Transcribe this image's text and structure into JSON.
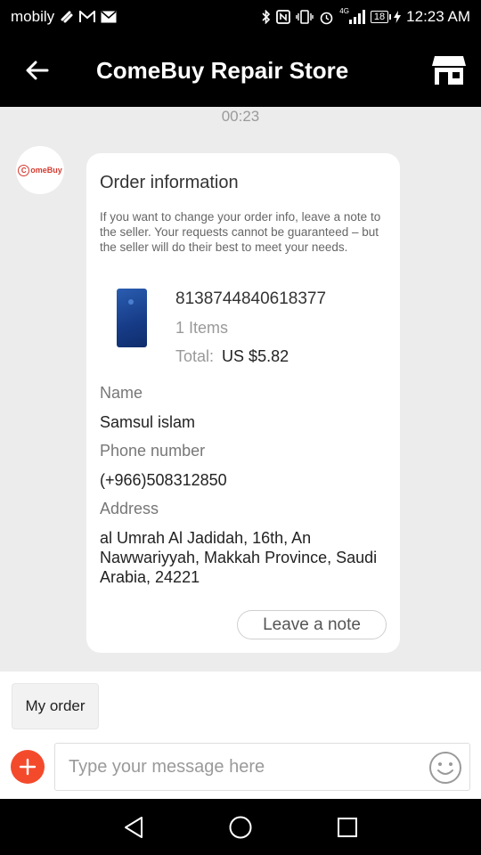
{
  "status_bar": {
    "carrier": "mobily",
    "network": "4G",
    "battery": "18",
    "time": "12:23 AM"
  },
  "header": {
    "title": "ComeBuy Repair Store",
    "back_icon": "arrow-left-icon",
    "store_icon": "store-icon"
  },
  "chat": {
    "timestamp": "00:23",
    "avatar_text": "omeBuy",
    "card": {
      "title": "Order information",
      "note": "If you want to change your order info, leave a note to the seller. Your requests cannot be guaranteed – but the seller will do their best to meet your needs.",
      "order_id": "8138744840618377",
      "items": "1 Items",
      "total_label": "Total:",
      "total_value": "US $5.82",
      "name_label": "Name",
      "name_value": "Samsul islam",
      "phone_label": "Phone number",
      "phone_value": "(+966)508312850",
      "address_label": "Address",
      "address_value": "al Umrah Al Jadidah, 16th, An Nawwariyyah, Makkah Province, Saudi Arabia, 24221",
      "leave_note": "Leave a note"
    }
  },
  "bottom": {
    "my_order": "My order",
    "input_placeholder": "Type your message here",
    "plus_icon": "plus-icon",
    "emoji_icon": "smiley-icon"
  },
  "colors": {
    "accent": "#f44a2c",
    "header_bg": "#000000",
    "chat_bg": "#ececec"
  }
}
